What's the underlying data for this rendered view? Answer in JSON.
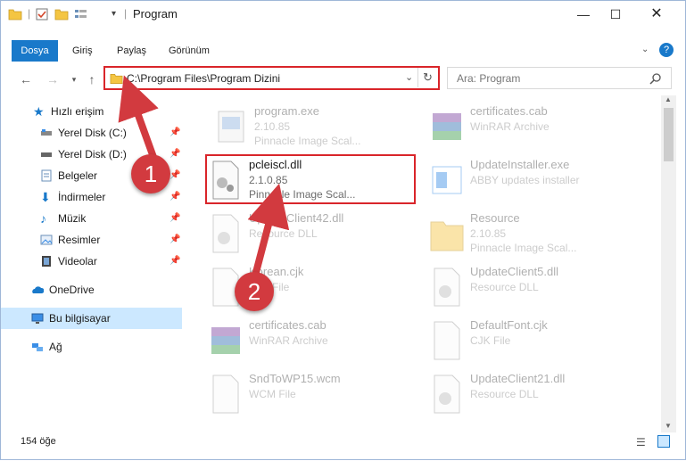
{
  "window": {
    "title": "Program"
  },
  "ribbon": {
    "tabs": [
      "Dosya",
      "Giriş",
      "Paylaş",
      "Görünüm"
    ]
  },
  "address": {
    "path": "C:\\Program Files\\Program Dizini"
  },
  "search": {
    "placeholder": "Ara: Program"
  },
  "sidebar": {
    "items": [
      {
        "label": "Hızlı erişim",
        "pinned": false
      },
      {
        "label": "Yerel Disk (C:)",
        "pinned": true
      },
      {
        "label": "Yerel Disk (D:)",
        "pinned": true
      },
      {
        "label": "Belgeler",
        "pinned": true
      },
      {
        "label": "İndirmeler",
        "pinned": true
      },
      {
        "label": "Müzik",
        "pinned": true
      },
      {
        "label": "Resimler",
        "pinned": true
      },
      {
        "label": "Videolar",
        "pinned": true
      },
      {
        "label": "OneDrive",
        "pinned": false
      },
      {
        "label": "Bu bilgisayar",
        "pinned": false
      },
      {
        "label": "Ağ",
        "pinned": false
      }
    ]
  },
  "files": [
    {
      "name": "program.exe",
      "version": "2.10.85",
      "type": "Pinnacle Image Scal..."
    },
    {
      "name": "certificates.cab",
      "version": "",
      "type": "WinRAR Archive"
    },
    {
      "name": "pcleiscl.dll",
      "version": "2.1.0.85",
      "type": "Pinnacle Image Scal..."
    },
    {
      "name": "UpdateInstaller.exe",
      "version": "",
      "type": "ABBY updates installer"
    },
    {
      "name": "UpdateClient42.dll",
      "version": "",
      "type": "Resource DLL"
    },
    {
      "name": "Resource",
      "version": "2.10.85",
      "type": "Pinnacle Image Scal..."
    },
    {
      "name": "Korean.cjk",
      "version": "",
      "type": "CJK File"
    },
    {
      "name": "UpdateClient5.dll",
      "version": "",
      "type": "Resource DLL"
    },
    {
      "name": "certificates.cab",
      "version": "",
      "type": "WinRAR Archive"
    },
    {
      "name": "DefaultFont.cjk",
      "version": "",
      "type": "CJK File"
    },
    {
      "name": "SndToWP15.wcm",
      "version": "",
      "type": "WCM File"
    },
    {
      "name": "UpdateClient21.dll",
      "version": "",
      "type": "Resource DLL"
    }
  ],
  "status": {
    "count": "154 öğe"
  },
  "annotations": [
    "1",
    "2"
  ],
  "colors": {
    "accent": "#1979ca",
    "highlight": "#d9252a",
    "badge": "#d23a3f",
    "selected": "#cce8ff"
  }
}
